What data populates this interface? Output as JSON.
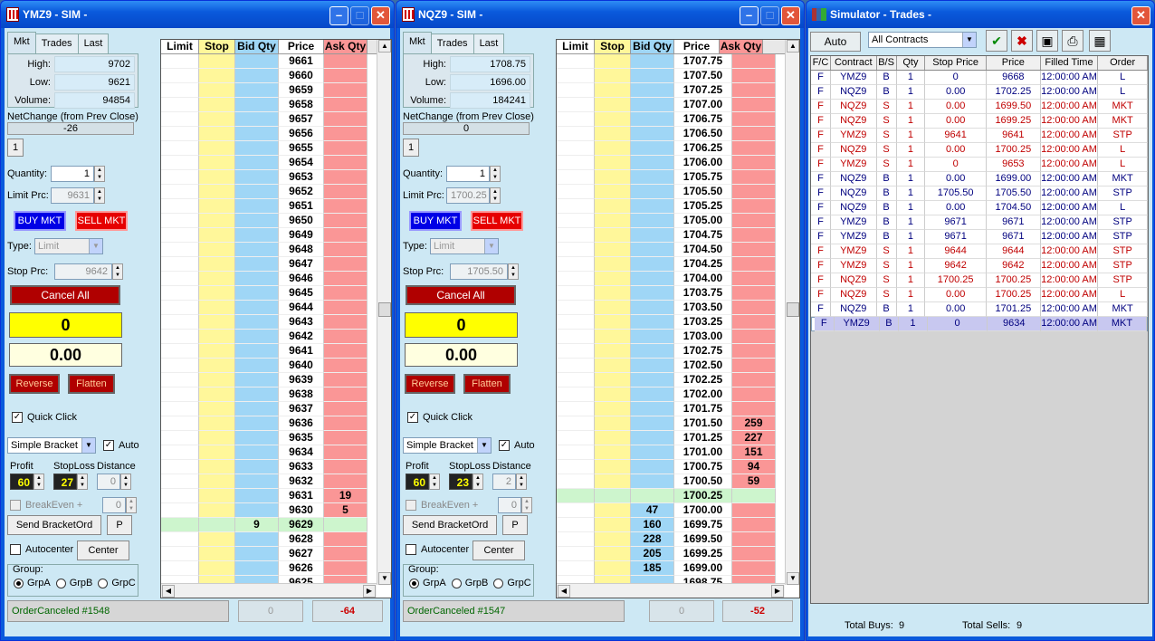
{
  "windows": [
    {
      "title": "YMZ9 - SIM -",
      "tabs": [
        "Mkt",
        "Trades",
        "Last"
      ],
      "high_label": "High:",
      "high": "9702",
      "low_label": "Low:",
      "low": "9621",
      "volume_label": "Volume:",
      "volume": "94854",
      "netchange_label": "NetChange (from Prev Close)",
      "netchange": "-26",
      "one_btn": "1",
      "quantity_label": "Quantity:",
      "quantity": "1",
      "limit_label": "Limit Prc:",
      "limit_price": "9631",
      "buy_mkt": "BUY MKT",
      "sell_mkt": "SELL MKT",
      "type_label": "Type:",
      "type_value": "Limit",
      "stop_label": "Stop Prc:",
      "stop_price": "9642",
      "cancel_all": "Cancel All",
      "position": "0",
      "pnl": "0.00",
      "reverse": "Reverse",
      "flatten": "Flatten",
      "quick_click": "Quick Click",
      "bracket_type": "Simple Bracket",
      "auto_label": "Auto",
      "profit_label": "Profit",
      "profit": "60",
      "stoploss_label": "StopLoss",
      "stoploss": "27",
      "distance_label": "Distance",
      "distance": "0",
      "breakeven_label": "BreakEven +",
      "breakeven": "0",
      "send_bracket": "Send BracketOrd",
      "p_btn": "P",
      "autocenter": "Autocenter",
      "center": "Center",
      "group_label": "Group:",
      "groups": [
        "GrpA",
        "GrpB",
        "GrpC"
      ],
      "status": "OrderCanceled #1548",
      "status_mid": "0",
      "status_right": "-64",
      "ladder_headers": [
        "Limit",
        "Stop",
        "Bid Qty",
        "Price",
        "Ask Qty"
      ],
      "ladder_rows": [
        {
          "price": "9661",
          "bid": "",
          "ask": ""
        },
        {
          "price": "9660",
          "bid": "",
          "ask": ""
        },
        {
          "price": "9659",
          "bid": "",
          "ask": ""
        },
        {
          "price": "9658",
          "bid": "",
          "ask": ""
        },
        {
          "price": "9657",
          "bid": "",
          "ask": ""
        },
        {
          "price": "9656",
          "bid": "",
          "ask": ""
        },
        {
          "price": "9655",
          "bid": "",
          "ask": ""
        },
        {
          "price": "9654",
          "bid": "",
          "ask": ""
        },
        {
          "price": "9653",
          "bid": "",
          "ask": ""
        },
        {
          "price": "9652",
          "bid": "",
          "ask": ""
        },
        {
          "price": "9651",
          "bid": "",
          "ask": ""
        },
        {
          "price": "9650",
          "bid": "",
          "ask": ""
        },
        {
          "price": "9649",
          "bid": "",
          "ask": ""
        },
        {
          "price": "9648",
          "bid": "",
          "ask": ""
        },
        {
          "price": "9647",
          "bid": "",
          "ask": ""
        },
        {
          "price": "9646",
          "bid": "",
          "ask": ""
        },
        {
          "price": "9645",
          "bid": "",
          "ask": ""
        },
        {
          "price": "9644",
          "bid": "",
          "ask": ""
        },
        {
          "price": "9643",
          "bid": "",
          "ask": ""
        },
        {
          "price": "9642",
          "bid": "",
          "ask": ""
        },
        {
          "price": "9641",
          "bid": "",
          "ask": ""
        },
        {
          "price": "9640",
          "bid": "",
          "ask": ""
        },
        {
          "price": "9639",
          "bid": "",
          "ask": ""
        },
        {
          "price": "9638",
          "bid": "",
          "ask": ""
        },
        {
          "price": "9637",
          "bid": "",
          "ask": ""
        },
        {
          "price": "9636",
          "bid": "",
          "ask": ""
        },
        {
          "price": "9635",
          "bid": "",
          "ask": ""
        },
        {
          "price": "9634",
          "bid": "",
          "ask": ""
        },
        {
          "price": "9633",
          "bid": "",
          "ask": ""
        },
        {
          "price": "9632",
          "bid": "",
          "ask": ""
        },
        {
          "price": "9631",
          "bid": "",
          "ask": "19"
        },
        {
          "price": "9630",
          "bid": "",
          "ask": "5"
        },
        {
          "price": "9629",
          "bid": "9",
          "ask": "",
          "current": true
        },
        {
          "price": "9628",
          "bid": "",
          "ask": ""
        },
        {
          "price": "9627",
          "bid": "",
          "ask": ""
        },
        {
          "price": "9626",
          "bid": "",
          "ask": ""
        },
        {
          "price": "9625",
          "bid": "",
          "ask": ""
        }
      ]
    },
    {
      "title": "NQZ9 - SIM -",
      "tabs": [
        "Mkt",
        "Trades",
        "Last"
      ],
      "high_label": "High:",
      "high": "1708.75",
      "low_label": "Low:",
      "low": "1696.00",
      "volume_label": "Volume:",
      "volume": "184241",
      "netchange_label": "NetChange (from Prev Close)",
      "netchange": "0",
      "one_btn": "1",
      "quantity_label": "Quantity:",
      "quantity": "1",
      "limit_label": "Limit Prc:",
      "limit_price": "1700.25",
      "buy_mkt": "BUY MKT",
      "sell_mkt": "SELL MKT",
      "type_label": "Type:",
      "type_value": "Limit",
      "stop_label": "Stop Prc:",
      "stop_price": "1705.50",
      "cancel_all": "Cancel All",
      "position": "0",
      "pnl": "0.00",
      "reverse": "Reverse",
      "flatten": "Flatten",
      "quick_click": "Quick Click",
      "bracket_type": "Simple Bracket",
      "auto_label": "Auto",
      "profit_label": "Profit",
      "profit": "60",
      "stoploss_label": "StopLoss",
      "stoploss": "23",
      "distance_label": "Distance",
      "distance": "2",
      "breakeven_label": "BreakEven +",
      "breakeven": "0",
      "send_bracket": "Send BracketOrd",
      "p_btn": "P",
      "autocenter": "Autocenter",
      "center": "Center",
      "group_label": "Group:",
      "groups": [
        "GrpA",
        "GrpB",
        "GrpC"
      ],
      "status": "OrderCanceled #1547",
      "status_mid": "0",
      "status_right": "-52",
      "ladder_headers": [
        "Limit",
        "Stop",
        "Bid Qty",
        "Price",
        "Ask Qty"
      ],
      "ladder_rows": [
        {
          "price": "1707.75",
          "bid": "",
          "ask": ""
        },
        {
          "price": "1707.50",
          "bid": "",
          "ask": ""
        },
        {
          "price": "1707.25",
          "bid": "",
          "ask": ""
        },
        {
          "price": "1707.00",
          "bid": "",
          "ask": ""
        },
        {
          "price": "1706.75",
          "bid": "",
          "ask": ""
        },
        {
          "price": "1706.50",
          "bid": "",
          "ask": ""
        },
        {
          "price": "1706.25",
          "bid": "",
          "ask": ""
        },
        {
          "price": "1706.00",
          "bid": "",
          "ask": ""
        },
        {
          "price": "1705.75",
          "bid": "",
          "ask": ""
        },
        {
          "price": "1705.50",
          "bid": "",
          "ask": ""
        },
        {
          "price": "1705.25",
          "bid": "",
          "ask": ""
        },
        {
          "price": "1705.00",
          "bid": "",
          "ask": ""
        },
        {
          "price": "1704.75",
          "bid": "",
          "ask": ""
        },
        {
          "price": "1704.50",
          "bid": "",
          "ask": ""
        },
        {
          "price": "1704.25",
          "bid": "",
          "ask": ""
        },
        {
          "price": "1704.00",
          "bid": "",
          "ask": ""
        },
        {
          "price": "1703.75",
          "bid": "",
          "ask": ""
        },
        {
          "price": "1703.50",
          "bid": "",
          "ask": ""
        },
        {
          "price": "1703.25",
          "bid": "",
          "ask": ""
        },
        {
          "price": "1703.00",
          "bid": "",
          "ask": ""
        },
        {
          "price": "1702.75",
          "bid": "",
          "ask": ""
        },
        {
          "price": "1702.50",
          "bid": "",
          "ask": ""
        },
        {
          "price": "1702.25",
          "bid": "",
          "ask": ""
        },
        {
          "price": "1702.00",
          "bid": "",
          "ask": ""
        },
        {
          "price": "1701.75",
          "bid": "",
          "ask": ""
        },
        {
          "price": "1701.50",
          "bid": "",
          "ask": "259"
        },
        {
          "price": "1701.25",
          "bid": "",
          "ask": "227"
        },
        {
          "price": "1701.00",
          "bid": "",
          "ask": "151"
        },
        {
          "price": "1700.75",
          "bid": "",
          "ask": "94"
        },
        {
          "price": "1700.50",
          "bid": "",
          "ask": "59"
        },
        {
          "price": "1700.25",
          "bid": "",
          "ask": "",
          "current": true
        },
        {
          "price": "1700.00",
          "bid": "47",
          "ask": ""
        },
        {
          "price": "1699.75",
          "bid": "160",
          "ask": ""
        },
        {
          "price": "1699.50",
          "bid": "228",
          "ask": ""
        },
        {
          "price": "1699.25",
          "bid": "205",
          "ask": ""
        },
        {
          "price": "1699.00",
          "bid": "185",
          "ask": ""
        },
        {
          "price": "1698.75",
          "bid": "",
          "ask": ""
        }
      ]
    }
  ],
  "trades_window": {
    "title": "Simulator - Trades -",
    "auto_btn": "Auto",
    "contract_filter": "All Contracts",
    "headers": [
      "F/C",
      "Contract",
      "B/S",
      "Qty",
      "Stop Price",
      "Price",
      "Filled Time",
      "Order"
    ],
    "rows": [
      {
        "fc": "F",
        "contract": "YMZ9",
        "bs": "B",
        "qty": "1",
        "stop": "0",
        "price": "9668",
        "time": "12:00:00 AM",
        "order": "L"
      },
      {
        "fc": "F",
        "contract": "NQZ9",
        "bs": "B",
        "qty": "1",
        "stop": "0.00",
        "price": "1702.25",
        "time": "12:00:00 AM",
        "order": "L"
      },
      {
        "fc": "F",
        "contract": "NQZ9",
        "bs": "S",
        "qty": "1",
        "stop": "0.00",
        "price": "1699.50",
        "time": "12:00:00 AM",
        "order": "MKT"
      },
      {
        "fc": "F",
        "contract": "NQZ9",
        "bs": "S",
        "qty": "1",
        "stop": "0.00",
        "price": "1699.25",
        "time": "12:00:00 AM",
        "order": "MKT"
      },
      {
        "fc": "F",
        "contract": "YMZ9",
        "bs": "S",
        "qty": "1",
        "stop": "9641",
        "price": "9641",
        "time": "12:00:00 AM",
        "order": "STP"
      },
      {
        "fc": "F",
        "contract": "NQZ9",
        "bs": "S",
        "qty": "1",
        "stop": "0.00",
        "price": "1700.25",
        "time": "12:00:00 AM",
        "order": "L"
      },
      {
        "fc": "F",
        "contract": "YMZ9",
        "bs": "S",
        "qty": "1",
        "stop": "0",
        "price": "9653",
        "time": "12:00:00 AM",
        "order": "L"
      },
      {
        "fc": "F",
        "contract": "NQZ9",
        "bs": "B",
        "qty": "1",
        "stop": "0.00",
        "price": "1699.00",
        "time": "12:00:00 AM",
        "order": "MKT"
      },
      {
        "fc": "F",
        "contract": "NQZ9",
        "bs": "B",
        "qty": "1",
        "stop": "1705.50",
        "price": "1705.50",
        "time": "12:00:00 AM",
        "order": "STP"
      },
      {
        "fc": "F",
        "contract": "NQZ9",
        "bs": "B",
        "qty": "1",
        "stop": "0.00",
        "price": "1704.50",
        "time": "12:00:00 AM",
        "order": "L"
      },
      {
        "fc": "F",
        "contract": "YMZ9",
        "bs": "B",
        "qty": "1",
        "stop": "9671",
        "price": "9671",
        "time": "12:00:00 AM",
        "order": "STP"
      },
      {
        "fc": "F",
        "contract": "YMZ9",
        "bs": "B",
        "qty": "1",
        "stop": "9671",
        "price": "9671",
        "time": "12:00:00 AM",
        "order": "STP"
      },
      {
        "fc": "F",
        "contract": "YMZ9",
        "bs": "S",
        "qty": "1",
        "stop": "9644",
        "price": "9644",
        "time": "12:00:00 AM",
        "order": "STP"
      },
      {
        "fc": "F",
        "contract": "YMZ9",
        "bs": "S",
        "qty": "1",
        "stop": "9642",
        "price": "9642",
        "time": "12:00:00 AM",
        "order": "STP"
      },
      {
        "fc": "F",
        "contract": "NQZ9",
        "bs": "S",
        "qty": "1",
        "stop": "1700.25",
        "price": "1700.25",
        "time": "12:00:00 AM",
        "order": "STP"
      },
      {
        "fc": "F",
        "contract": "NQZ9",
        "bs": "S",
        "qty": "1",
        "stop": "0.00",
        "price": "1700.25",
        "time": "12:00:00 AM",
        "order": "L"
      },
      {
        "fc": "F",
        "contract": "NQZ9",
        "bs": "B",
        "qty": "1",
        "stop": "0.00",
        "price": "1701.25",
        "time": "12:00:00 AM",
        "order": "MKT"
      },
      {
        "fc": "F",
        "contract": "YMZ9",
        "bs": "B",
        "qty": "1",
        "stop": "0",
        "price": "9634",
        "time": "12:00:00 AM",
        "order": "MKT",
        "selected": true
      }
    ],
    "total_buys_label": "Total Buys:",
    "total_buys": "9",
    "total_sells_label": "Total Sells:",
    "total_sells": "9"
  },
  "colors": {
    "buy_row": "#00007f",
    "sell_row": "#c00000",
    "titlebar": "#0a5adc",
    "bid_col": "#9fd6f6",
    "ask_col": "#fa9696",
    "stop_col": "#fff79a"
  },
  "icons": [
    "chart-window-icon",
    "books-window-icon",
    "check-icon",
    "x-delete-icon",
    "save-disk-icon",
    "print-icon",
    "grid-icon"
  ]
}
